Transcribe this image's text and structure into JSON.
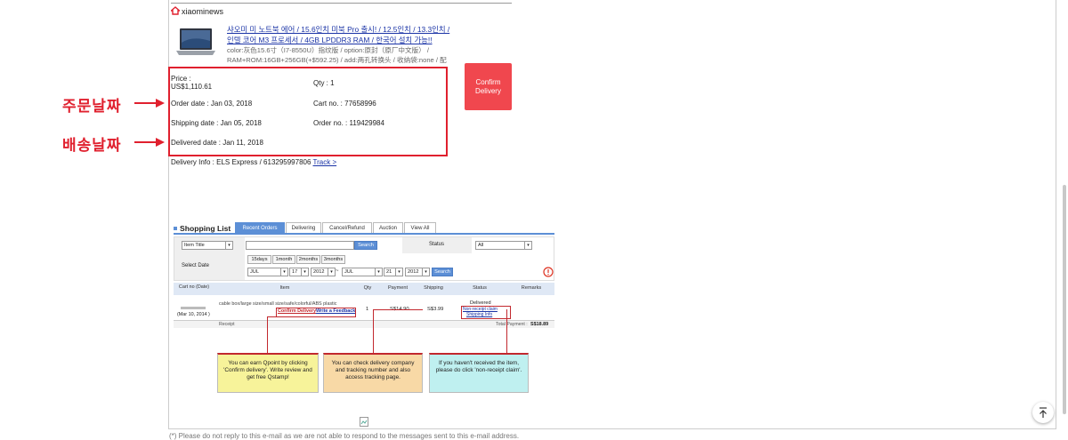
{
  "shop": {
    "name": "xiaominews"
  },
  "product": {
    "title": "샤오미 미 노트북 에어 / 15.6인치 미북 Pro 출시! / 12.5인치 / 13.3인치 / 인텔 코어 M3 프로세서 / 4GB LPDDR3 RAM / 한국어 설치 가능!!",
    "options": "color:灰色15.6寸（I7-8550U）指纹版 / option:原封（原厂中文版） / RAM+ROM:16GB+256GB(+$592.25) / add:两孔转换头 / 收纳袋:none / 配"
  },
  "order": {
    "price_label": "Price :",
    "price_value": "US$1,110.61",
    "qty": "Qty : 1",
    "order_date": "Order date : Jan 03, 2018",
    "cart_no": "Cart no. : 77658996",
    "shipping_date": "Shipping date : Jan 05, 2018",
    "order_no": "Order no. : 119429984",
    "delivered_date": "Delivered date : Jan 11, 2018"
  },
  "confirm_button": {
    "line1": "Confirm",
    "line2": "Delivery"
  },
  "annotations": {
    "order_date": "주문날짜",
    "delivery_date": "배송날짜"
  },
  "delivery": {
    "info": "Delivery Info : ELS Express / 613295997806",
    "track": "Track >"
  },
  "shopping_list": {
    "title": "Shopping List",
    "tabs": [
      "Recent Orders",
      "Delivering",
      "Cancel/Refund",
      "Auction",
      "View All"
    ],
    "filter": {
      "item_title": "Item Title",
      "search": "Search",
      "status_label": "Status",
      "status_value": "All",
      "select_date": "Select Date",
      "ranges": [
        "15days",
        "1month",
        "2months",
        "3months"
      ],
      "from_month": "JUL",
      "from_day": "17",
      "from_year": "2012",
      "tilde": "~",
      "to_month": "JUL",
      "to_day": "21",
      "to_year": "2012"
    },
    "headers": [
      "Cart no (Date)",
      "Item",
      "Qty",
      "Payment",
      "Shipping",
      "Status",
      "Remarks"
    ],
    "row": {
      "date": "(Mar 10, 2014 )",
      "item": "cable box/large size/small size/safe/colorful/ABS plastic",
      "confirm": "Confirm Delivery",
      "feedback": "Write a Feedback",
      "qty": "1",
      "payment": "S$14.90",
      "shipping": "S$3.99",
      "status": "Delivered",
      "non_receipt": "Non-receipt claim",
      "shipping_info": "Shipping Info"
    },
    "receipt": "Receipt",
    "total_label": "Total Payment :",
    "total_value": "S$18.89"
  },
  "notes": {
    "yellow": "You can earn Qpoint by clicking 'Confirm delivery'. Write review and get free Qstamp!",
    "orange": "You can check delivery company and tracking number and also access tracking page.",
    "cyan": "If you haven't received the item, please do click 'non-receipt claim'."
  },
  "footer": {
    "note": "(*) Please do not reply to this e-mail as we are not able to respond to the messages sent to this e-mail address."
  },
  "colors": {
    "red": "#e0202e",
    "link": "#1a33a6",
    "confirm": "#f0474e",
    "tab_blue": "#5c8fd6"
  }
}
